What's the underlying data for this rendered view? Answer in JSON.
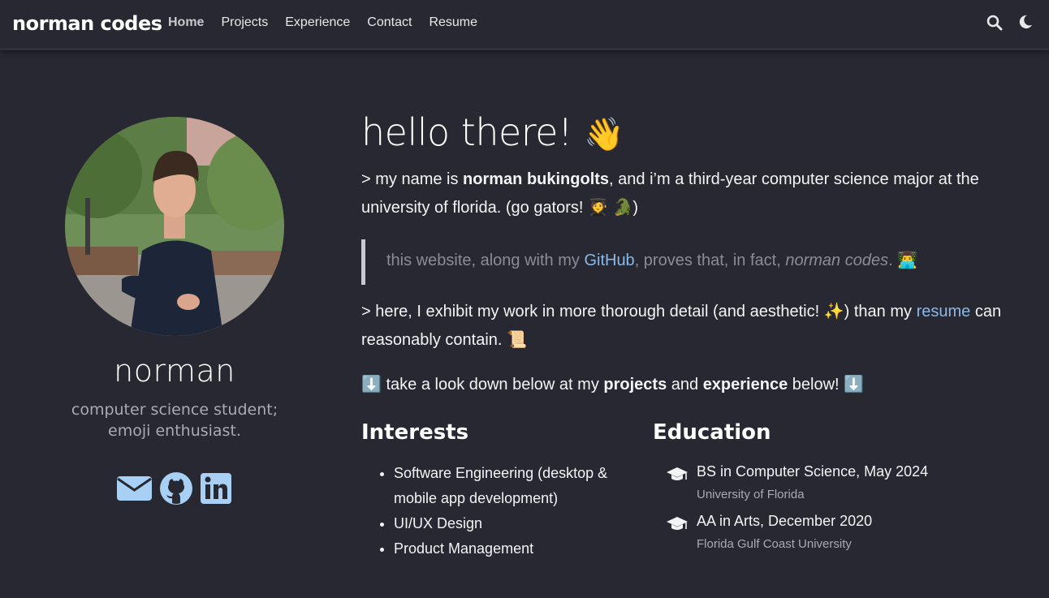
{
  "nav": {
    "brand": "norman codes",
    "links": [
      "Home",
      "Projects",
      "Experience",
      "Contact",
      "Resume"
    ],
    "active": "Home",
    "icons": [
      "search-icon",
      "moon-icon"
    ]
  },
  "sidebar": {
    "name": "norman",
    "tagline_1": "computer science student;",
    "tagline_2": "emoji enthusiast.",
    "socials": [
      "email-icon",
      "github-icon",
      "linkedin-icon"
    ],
    "accent": "#a8d0f5"
  },
  "main": {
    "hero": "hello there!",
    "hero_emoji": "👋",
    "p1": {
      "pre": "> my name is ",
      "bold": "norman bukingolts",
      "post": ", and i’m a third-year computer science major at the university of florida. (go gators! 🧑‍🎓 🐊)"
    },
    "quote": {
      "pre": "this website, along with my ",
      "link": "GitHub",
      "mid": ", proves that, in fact, ",
      "em": "norman codes",
      "post": ". 👨‍💻"
    },
    "p2": {
      "pre": "> here, I exhibit my work in more thorough detail (and aesthetic! ✨) than my ",
      "link": "resume",
      "post": " can reasonably contain. 📜"
    },
    "p3": {
      "pre": "⬇️ take a look down below at my ",
      "b1": "projects",
      "mid": " and ",
      "b2": "experience",
      "post": " below! ⬇️"
    },
    "interests_title": "Interests",
    "interests": [
      "Software Engineering (desktop & mobile app development)",
      "UI/UX Design",
      "Product Management"
    ],
    "education_title": "Education",
    "education": [
      {
        "title": "BS in Computer Science, May 2024",
        "school": "University of Florida"
      },
      {
        "title": "AA in Arts, December 2020",
        "school": "Florida Gulf Coast University"
      }
    ]
  }
}
